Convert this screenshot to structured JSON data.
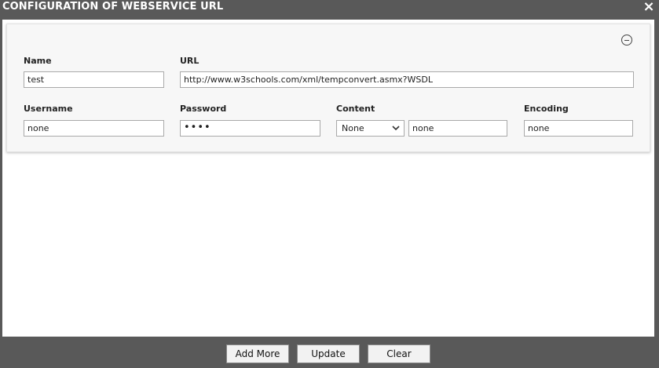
{
  "dialog": {
    "title": "CONFIGURATION OF WEBSERVICE URL",
    "close_icon": "×"
  },
  "form": {
    "name_label": "Name",
    "name_value": "test",
    "url_label": "URL",
    "url_value": "http://www.w3schools.com/xml/tempconvert.asmx?WSDL",
    "username_label": "Username",
    "username_value": "none",
    "password_label": "Password",
    "password_masked": "••••",
    "content_label": "Content",
    "content_type_selected": "None",
    "content_value": "none",
    "encoding_label": "Encoding",
    "encoding_value": "none"
  },
  "footer": {
    "add_more_label": "Add More",
    "update_label": "Update",
    "clear_label": "Clear"
  }
}
